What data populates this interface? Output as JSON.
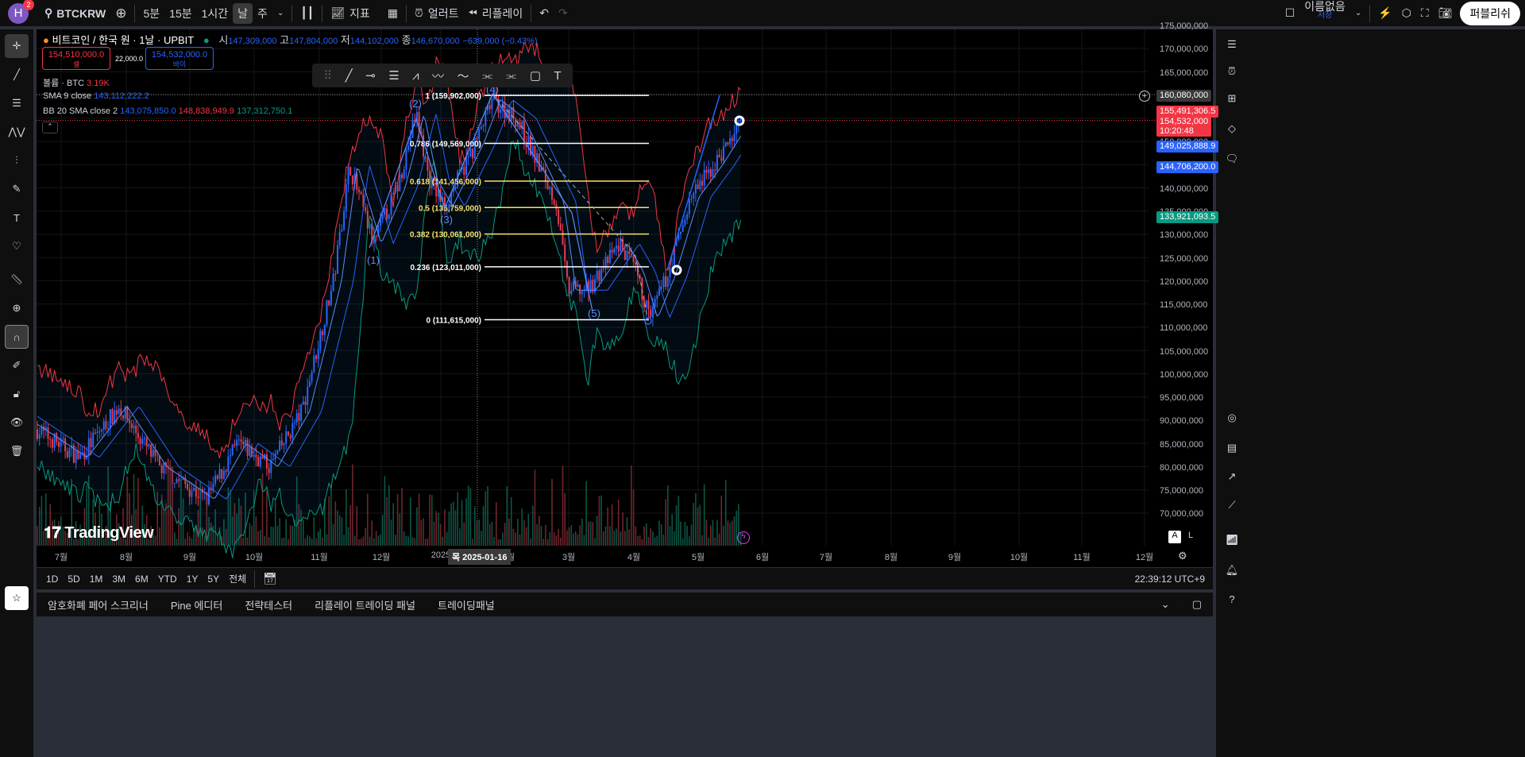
{
  "topbar": {
    "avatar": "H",
    "notif": "2",
    "symbol": "BTCKRW",
    "intervals": [
      "5분",
      "15분",
      "1시간",
      "날",
      "주"
    ],
    "indicators": "지표",
    "alert": "얼러트",
    "replay": "리플레이",
    "layout_name": "이름없음",
    "save": "저장",
    "publish": "퍼블리쉬"
  },
  "legend": {
    "title": "비트코인 / 한국 원 · 1날 · UPBIT",
    "o_label": "시",
    "o": "147,309,000",
    "h_label": "고",
    "h": "147,804,000",
    "l_label": "저",
    "l": "144,102,000",
    "c_label": "종",
    "c": "146,670,000",
    "chg": "−639,000 (−0.43%)",
    "sell_price": "154,510,000.0",
    "sell_label": "셀",
    "spread": "22,000.0",
    "buy_price": "154,532,000.0",
    "buy_label": "바이",
    "vol_label": "볼륨 · BTC",
    "vol": "3.19K",
    "sma_label": "SMA 9 close",
    "sma": "143,112,222.2",
    "bb_label": "BB 20 SMA close 2",
    "bb_mid": "143,075,850.0",
    "bb_up": "148,838,949.9",
    "bb_low": "137,312,750.1"
  },
  "price_axis": [
    "175,000,000",
    "170,000,000",
    "165,000,000",
    "160,000,000",
    "155,000,000",
    "150,000,000",
    "145,000,000",
    "140,000,000",
    "135,000,000",
    "130,000,000",
    "125,000,000",
    "120,000,000",
    "115,000,000",
    "110,000,000",
    "105,000,000",
    "100,000,000",
    "95,000,000",
    "90,000,000",
    "85,000,000",
    "80,000,000",
    "75,000,000",
    "70,000,000"
  ],
  "price_labels": {
    "crosshair": "160,080,000",
    "bb_upper": "155,491,306.5",
    "last": "154,532,000",
    "countdown": "10:20:48",
    "sma": "149,025,888.9",
    "bb_mid": "144,706,200.0",
    "bb_lower": "133,921,093.5"
  },
  "colors": {
    "up": "#089981",
    "down": "#f23645",
    "blue": "#2962ff",
    "bb_upper": "#f23645",
    "bb_lower": "#089981"
  },
  "fib": [
    {
      "label": "1 (159,902,000)",
      "price": 159902000,
      "color": "#ffffff"
    },
    {
      "label": "0.786 (149,569,000)",
      "price": 149569000,
      "color": "#ffffff"
    },
    {
      "label": "0.618 (141,456,000)",
      "price": 141456000,
      "color": "#f7e26b"
    },
    {
      "label": "0.5 (135,759,000)",
      "price": 135759000,
      "color": "#f7e26b"
    },
    {
      "label": "0.382 (130,061,000)",
      "price": 130061000,
      "color": "#f7e26b"
    },
    {
      "label": "0.236 (123,011,000)",
      "price": 123011000,
      "color": "#ffffff"
    },
    {
      "label": "0 (111,615,000)",
      "price": 111615000,
      "color": "#ffffff"
    }
  ],
  "waves": [
    "(1)",
    "(2)",
    "(3)",
    "(4)",
    "(5)"
  ],
  "time_axis": [
    "7월",
    "8월",
    "9월",
    "10월",
    "11월",
    "12월",
    "2025",
    "2월",
    "3월",
    "4월",
    "5월",
    "6월",
    "7월",
    "8월",
    "9월",
    "10월",
    "11월",
    "12월"
  ],
  "crosshair_date": "목 2025-01-16",
  "scale": {
    "a": "A",
    "l": "L"
  },
  "ranges": [
    "1D",
    "5D",
    "1M",
    "3M",
    "6M",
    "YTD",
    "1Y",
    "5Y",
    "전체"
  ],
  "clock": "22:39:12 UTC+9",
  "panels": [
    "암호화폐 페어 스크리너",
    "Pine 에디터",
    "전략테스터",
    "리플레이 트레이딩 패널",
    "트레이딩패널"
  ],
  "watermark": "TradingView"
}
